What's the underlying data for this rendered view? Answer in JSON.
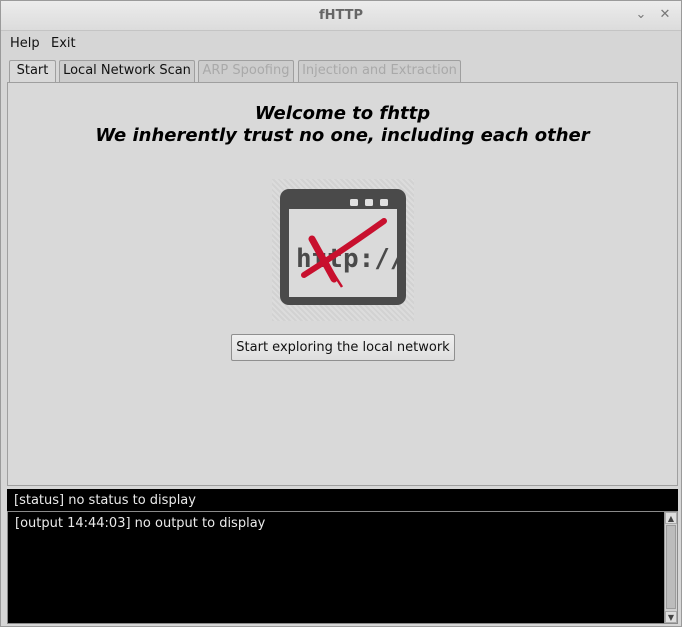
{
  "window": {
    "title": "fHTTP",
    "minimize_glyph": "⌄",
    "close_glyph": "✕"
  },
  "menu": {
    "items": [
      {
        "label": "Help"
      },
      {
        "label": "Exit"
      }
    ]
  },
  "tabs": [
    {
      "label": "Start",
      "state": "active"
    },
    {
      "label": "Local Network Scan",
      "state": "enabled"
    },
    {
      "label": "ARP Spoofing",
      "state": "disabled"
    },
    {
      "label": "Injection and Extraction",
      "state": "disabled"
    }
  ],
  "start": {
    "welcome_line1": "Welcome to fhttp",
    "welcome_line2": "We inherently trust no one, including each other",
    "logo_text": "http://",
    "cta_label": "Start exploring the local network"
  },
  "status": {
    "text": "[status] no status to display"
  },
  "output": {
    "text": "[output 14:44:03] no output to display"
  },
  "colors": {
    "accent_red": "#c8102e",
    "logo_dark": "#4a4a4a",
    "console_bg": "#000000"
  },
  "icons": {
    "logo": "browser-http-crossed-icon",
    "scroll_up": "scroll-up-arrow-icon",
    "scroll_down": "scroll-down-arrow-icon"
  }
}
